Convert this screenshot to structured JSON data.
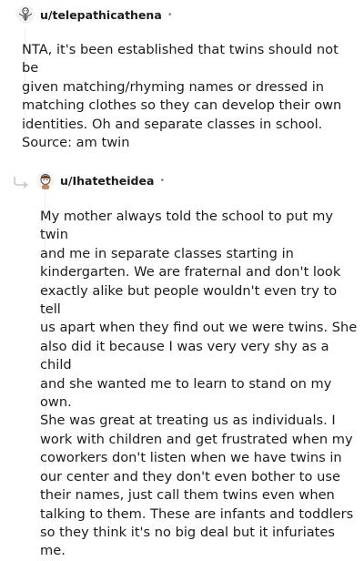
{
  "comments": [
    {
      "username": "u/telepathicathena",
      "separator": "•",
      "avatar_icon": "skeleton-avatar-icon",
      "body": [
        "NTA, it's been established that twins should not be",
        "given matching/rhyming names or dressed in",
        "matching clothes so they can develop their own",
        "identities. Oh and separate classes in school.",
        "Source: am twin"
      ]
    },
    {
      "username": "u/Ihatetheidea",
      "separator": "•",
      "avatar_icon": "snoo-avatar-icon",
      "reply_icon": "reply-arrow-icon",
      "body": [
        "My mother always told the school to put my twin",
        "and me in separate classes starting in",
        "kindergarten. We are fraternal and don't look",
        "exactly alike but people wouldn't even try to tell",
        "us apart when they find out we were twins. She",
        "also did it because I was very very shy as a child",
        "and she wanted me to learn to stand on my own.",
        "She was great at treating us as individuals. I",
        "work with children and get frustrated when my",
        "coworkers don't listen when we have twins in",
        "our center and they don't even bother to use",
        "their names, just call them twins even when",
        "talking to them. These are infants and toddlers",
        "so they think it's no big deal but it infuriates me."
      ]
    }
  ]
}
